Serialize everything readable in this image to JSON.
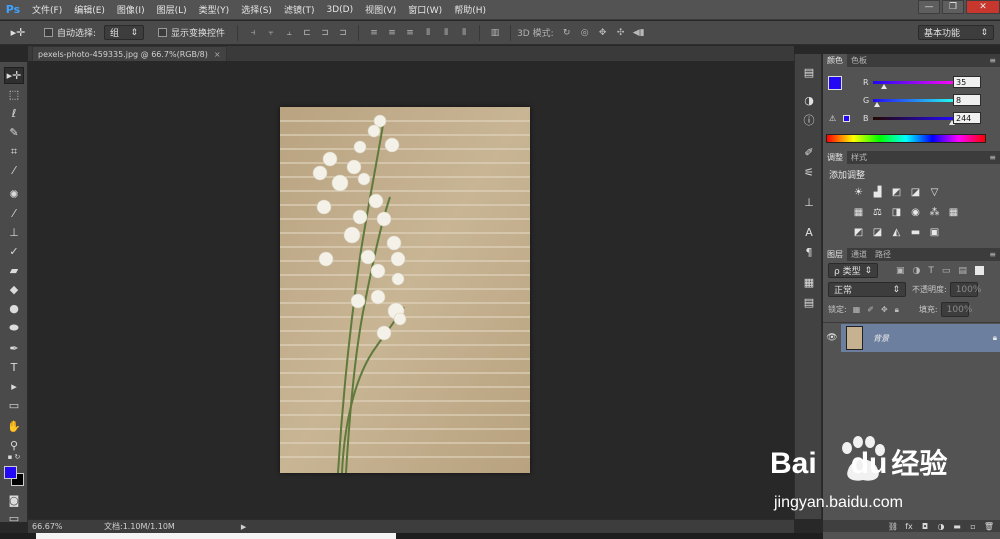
{
  "app": {
    "logo": "Ps",
    "menu": [
      "文件(F)",
      "编辑(E)",
      "图像(I)",
      "图层(L)",
      "类型(Y)",
      "选择(S)",
      "滤镜(T)",
      "3D(D)",
      "视图(V)",
      "窗口(W)",
      "帮助(H)"
    ],
    "window_controls": [
      "—",
      "❐",
      "✕"
    ]
  },
  "options_bar": {
    "auto_select_label": "自动选择:",
    "auto_select_value": "组",
    "show_transform_label": "显示变换控件",
    "mode_3d_label": "3D 模式:",
    "workspace": "基本功能"
  },
  "document": {
    "tab_title": "pexels-photo-459335.jpg @ 66.7%(RGB/8)",
    "close": "×"
  },
  "status": {
    "zoom": "66.67%",
    "doc_info": "文档:1.10M/1.10M",
    "arrow": "▶"
  },
  "panels": {
    "color": {
      "tabs": [
        "颜色",
        "色板"
      ],
      "r_label": "R",
      "r_value": "35",
      "g_label": "G",
      "g_value": "8",
      "b_label": "B",
      "b_value": "244",
      "foreground_color": "#2308f4"
    },
    "adjustments": {
      "tabs": [
        "调整",
        "样式"
      ],
      "heading": "添加调整"
    },
    "layers": {
      "tabs": [
        "图层",
        "通道",
        "路径"
      ],
      "filter_label": "ρ 类型",
      "blend_mode": "正常",
      "opacity_label": "不透明度:",
      "opacity_value": "100%",
      "lock_label": "锁定:",
      "fill_label": "填充:",
      "fill_value": "100%",
      "layer_name": "背景"
    }
  },
  "watermark": {
    "brand": "Bai",
    "brand_suffix": "du",
    "cn": "经验",
    "url": "jingyan.baidu.com"
  }
}
